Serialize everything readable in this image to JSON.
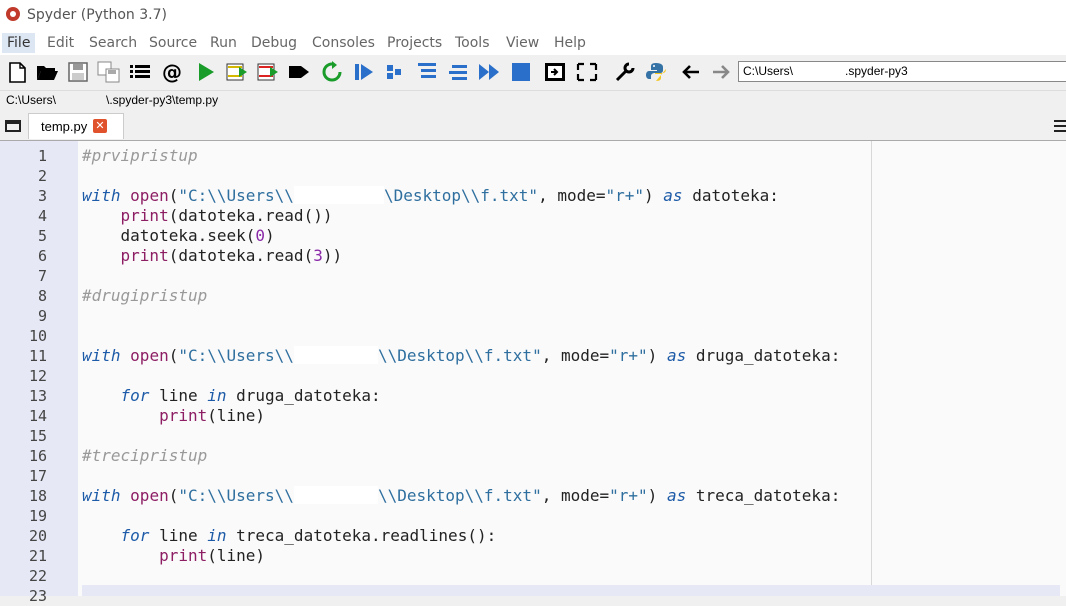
{
  "window": {
    "title": "Spyder (Python 3.7)"
  },
  "menu": [
    "File",
    "Edit",
    "Search",
    "Source",
    "Run",
    "Debug",
    "Consoles",
    "Projects",
    "Tools",
    "View",
    "Help"
  ],
  "toolbar": {
    "path_value": "C:\\Users\\",
    "path_suffix": ".spyder-py3"
  },
  "current_file_path": {
    "prefix": "C:\\Users\\",
    "suffix": "\\.spyder-py3\\temp.py"
  },
  "tabs": [
    {
      "label": "temp.py",
      "close": "✕"
    }
  ],
  "editor": {
    "line_numbers": [
      "1",
      "2",
      "3",
      "4",
      "5",
      "6",
      "7",
      "8",
      "9",
      "10",
      "11",
      "12",
      "13",
      "14",
      "15",
      "16",
      "17",
      "18",
      "19",
      "20",
      "21",
      "22",
      "23"
    ],
    "lines": {
      "l1": "#prvipristup",
      "l3_kw": "with",
      "l3_fn": "open",
      "l3_s1": "\"C:\\\\Users\\\\",
      "l3_s2": "\\Desktop\\\\f.txt\"",
      "l3_mid": ", mode=",
      "l3_s3": "\"r+\"",
      "l3_as": "as",
      "l3_end": " datoteka:",
      "l4_fn": "print",
      "l4_rest": "(datoteka.read())",
      "l5_a": "datoteka.seek(",
      "l5_n": "0",
      "l5_b": ")",
      "l6_fn": "print",
      "l6_a": "(datoteka.read(",
      "l6_n": "3",
      "l6_b": "))",
      "l8": "#drugipristup",
      "l11_kw": "with",
      "l11_fn": "open",
      "l11_s1": "\"C:\\\\Users\\\\",
      "l11_s2": "\\\\Desktop\\\\f.txt\"",
      "l11_mid": ", mode=",
      "l11_s3": "\"r+\"",
      "l11_as": "as",
      "l11_end": " druga_datoteka:",
      "l13_for": "for",
      "l13_a": " line ",
      "l13_in": "in",
      "l13_b": " druga_datoteka:",
      "l14_fn": "print",
      "l14_rest": "(line)",
      "l16": "#trecipristup",
      "l18_kw": "with",
      "l18_fn": "open",
      "l18_s1": "\"C:\\\\Users\\\\",
      "l18_s2": "\\\\Desktop\\\\f.txt\"",
      "l18_mid": ", mode=",
      "l18_s3": "\"r+\"",
      "l18_as": "as",
      "l18_end": " treca_datoteka:",
      "l20_for": "for",
      "l20_a": " line ",
      "l20_in": "in",
      "l20_b": " treca_datoteka.readlines():",
      "l21_fn": "print",
      "l21_rest": "(line)"
    }
  }
}
